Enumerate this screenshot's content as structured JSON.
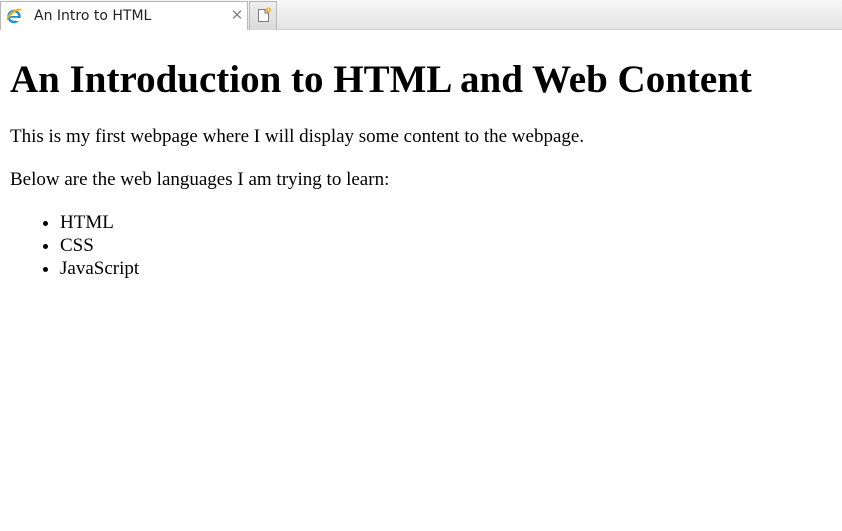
{
  "browser": {
    "tab_title": "An Intro to HTML",
    "tab_close_symbol": "✕",
    "tab_icon": "internet-explorer-icon",
    "new_tab_icon": "new-tab-icon",
    "accent_color": "#1e90d6"
  },
  "page": {
    "heading": "An Introduction to HTML and Web Content",
    "intro_paragraph": "This is my first webpage where I will display some content to the webpage.",
    "list_intro": "Below are the web languages I am trying to learn:",
    "languages": [
      "HTML",
      "CSS",
      "JavaScript"
    ]
  }
}
